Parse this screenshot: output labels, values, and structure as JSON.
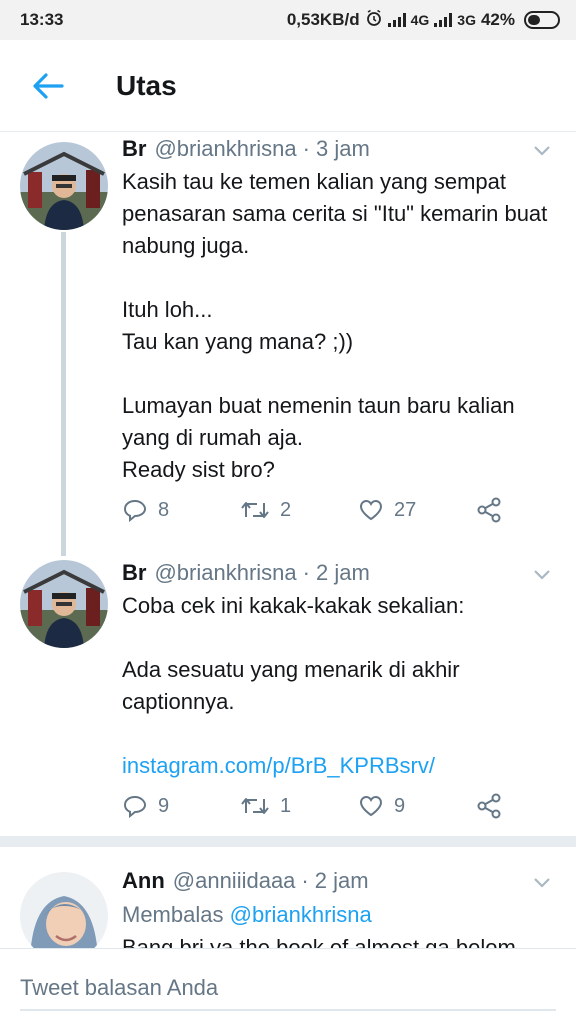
{
  "status_bar": {
    "time": "13:33",
    "speed": "0,53KB/d",
    "net1": "4G",
    "net2": "3G",
    "battery": "42%"
  },
  "app_bar": {
    "title": "Utas",
    "back_icon": "arrow-left-icon"
  },
  "colors": {
    "accent": "#1da1f2",
    "muted": "#657786",
    "text": "#14171a",
    "thread_line": "#ccd6dd"
  },
  "tweets": [
    {
      "name": "Br",
      "handle": "@briankhrisna",
      "time": "3 jam",
      "text": "Kasih tau ke temen kalian yang sempat penasaran sama cerita si \"Itu\" kemarin buat nabung juga.\n\nItuh loh...\nTau kan yang mana? ;))\n\nLumayan buat nemenin taun baru kalian yang di rumah aja.\nReady sist bro?",
      "replies": "8",
      "retweets": "2",
      "likes": "27"
    },
    {
      "name": "Br",
      "handle": "@briankhrisna",
      "time": "2 jam",
      "text": "Coba cek ini kakak-kakak sekalian:\n\nAda sesuatu yang menarik di akhir captionnya.",
      "link": "instagram.com/p/BrB_KPRBsrv/",
      "replies": "9",
      "retweets": "1",
      "likes": "9"
    },
    {
      "name": "Ann",
      "handle": "@anniiidaaa",
      "time": "2 jam",
      "reply_prefix": "Membalas",
      "reply_mention": "@briankhrisna",
      "text": "Bang bri ya the book of almost ga belom"
    }
  ],
  "reply_box": {
    "placeholder": "Tweet balasan Anda"
  }
}
